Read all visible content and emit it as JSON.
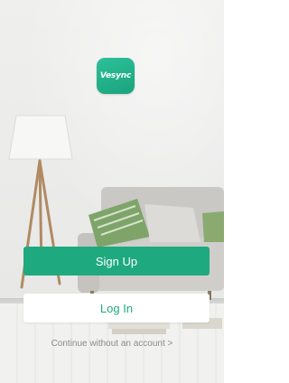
{
  "logo": {
    "text": "Vesync"
  },
  "buttons": {
    "signup_label": "Sign Up",
    "login_label": "Log In"
  },
  "continue_link": "Continue without an account >",
  "colors": {
    "accent": "#1fa97e",
    "background": "#ebebea",
    "link_text": "#8b8b8b"
  },
  "background_scene": "living room with sofa and floor lamp"
}
